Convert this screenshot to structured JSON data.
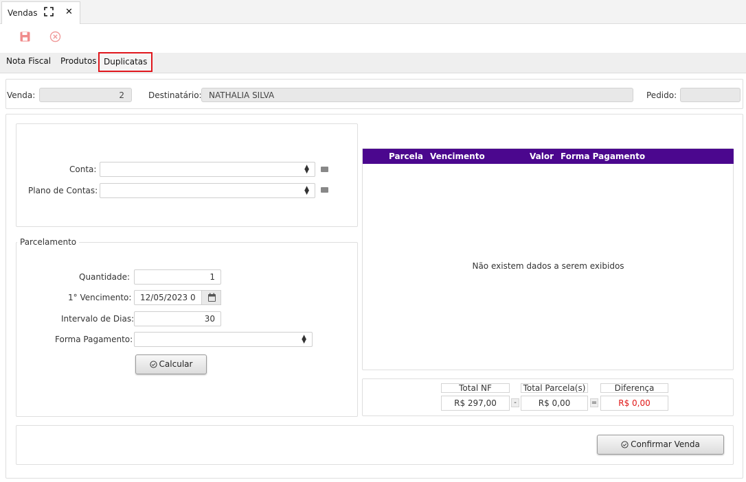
{
  "window_tab": {
    "label": "Vendas",
    "maximize_icon": "maximize-icon",
    "close_label": "✕"
  },
  "toolbar": {
    "save_icon": "save-icon",
    "cancel_icon": "cancel-icon",
    "accent": "#f08080"
  },
  "section_tabs": [
    {
      "label": "Nota Fiscal"
    },
    {
      "label": "Produtos"
    },
    {
      "label": "Duplicatas",
      "active": true
    }
  ],
  "header": {
    "venda_label": "Venda:",
    "venda_value": "2",
    "destinatario_label": "Destinatário:",
    "destinatario_value": "NATHALIA SILVA",
    "pedido_label": "Pedido:",
    "pedido_value": ""
  },
  "conta_form": {
    "conta_label": "Conta:",
    "conta_value": "",
    "plano_label": "Plano de Contas:",
    "plano_value": ""
  },
  "parcelamento": {
    "legend": "Parcelamento",
    "quantidade_label": "Quantidade:",
    "quantidade_value": "1",
    "vencimento_label": "1°  Vencimento:",
    "vencimento_value": "12/05/2023 0",
    "intervalo_label": "Intervalo de Dias:",
    "intervalo_value": "30",
    "forma_label": "Forma Pagamento:",
    "forma_value": "",
    "calcular_label": "Calcular"
  },
  "grid": {
    "header_color": "#4b078e",
    "columns": [
      "Parcela",
      "Vencimento",
      "Valor",
      "Forma Pagamento"
    ],
    "empty_message": "Não existem dados a serem exibidos"
  },
  "totals": {
    "total_nf_label": "Total NF",
    "total_nf_value": "R$ 297,00",
    "minus": "-",
    "total_parcelas_label": "Total Parcela(s)",
    "total_parcelas_value": "R$ 0,00",
    "equals": "=",
    "diferenca_label": "Diferença",
    "diferenca_value": "R$ 0,00",
    "diferenca_color": "#e01515"
  },
  "footer": {
    "confirmar_label": "Confirmar Venda"
  }
}
